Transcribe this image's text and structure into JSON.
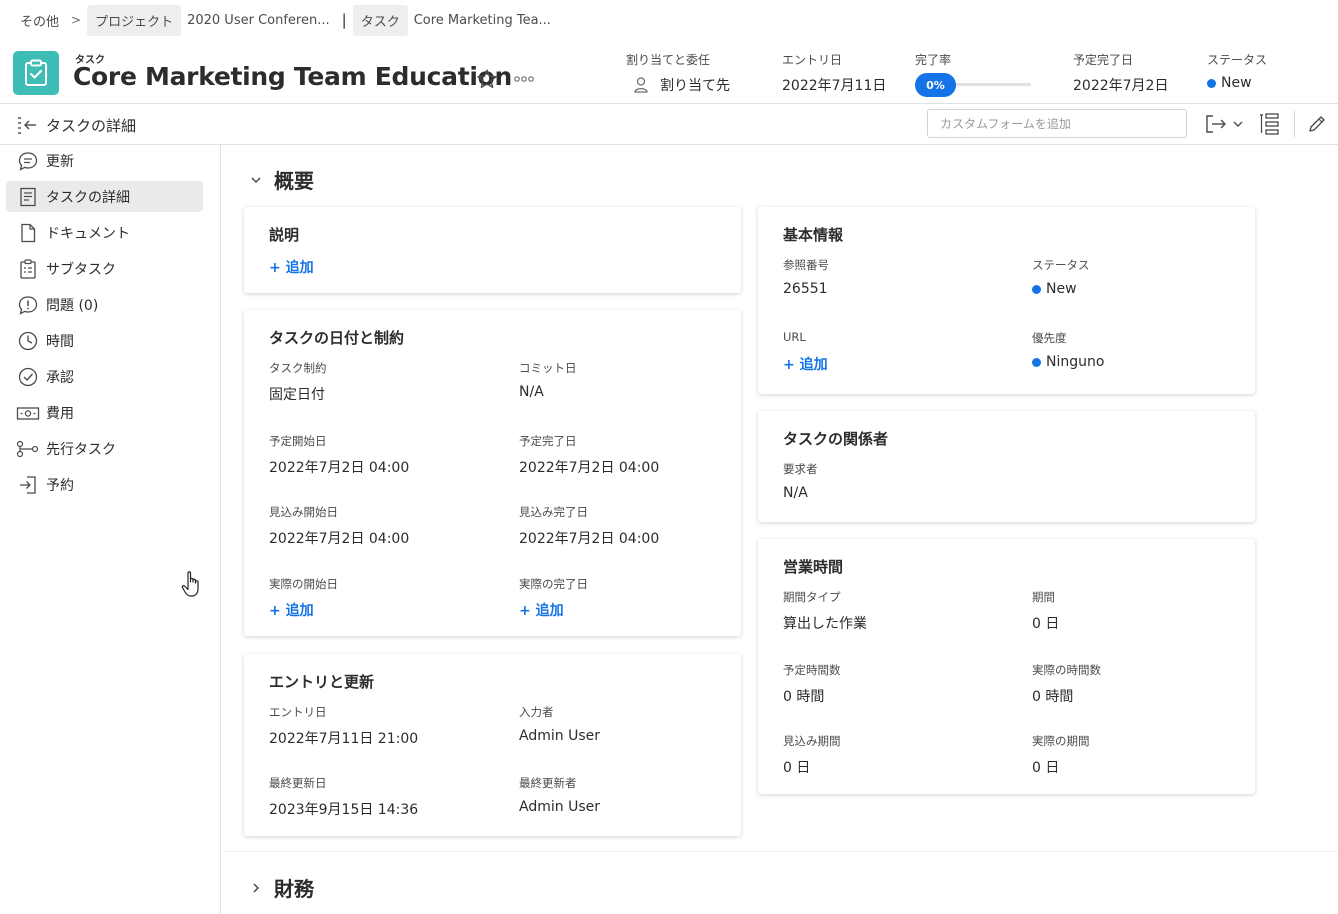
{
  "breadcrumb": {
    "items": [
      "その他",
      "プロジェクト",
      "2020 User Conferen...",
      "タスク",
      "Core Marketing Tea..."
    ],
    "separator": ">",
    "pipe": "|"
  },
  "header": {
    "object_label": "タスク",
    "title": "Core Marketing Team Education",
    "fields": {
      "assign_label": "割り当てと委任",
      "assign_value": "割り当て先",
      "entry_label": "エントリ日",
      "entry_value": "2022年7月11日",
      "complete_label": "完了率",
      "complete_value": "0%",
      "complete_fraction": 0,
      "planned_label": "予定完了日",
      "planned_value": "2022年7月2日",
      "status_label": "ステータス",
      "status_value": "New"
    },
    "icons": [
      "clipboard-icon",
      "star-icon",
      "more-icon",
      "user-icon"
    ]
  },
  "toolbar": {
    "title": "タスクの詳細",
    "custom_form_placeholder": "カスタムフォームを追加",
    "icons": [
      "collapse-panel-icon",
      "export-icon",
      "chevron-down-icon",
      "layout-list-icon",
      "edit-icon"
    ]
  },
  "sidebar": {
    "items": [
      {
        "label": "更新",
        "icon": "comment-icon"
      },
      {
        "label": "タスクの詳細",
        "icon": "details-icon",
        "active": true
      },
      {
        "label": "ドキュメント",
        "icon": "document-icon"
      },
      {
        "label": "サブタスク",
        "icon": "subtask-icon"
      },
      {
        "label": "問題 (0)",
        "icon": "issue-icon"
      },
      {
        "label": "時間",
        "icon": "clock-icon"
      },
      {
        "label": "承認",
        "icon": "approval-icon"
      },
      {
        "label": "費用",
        "icon": "expense-icon"
      },
      {
        "label": "先行タスク",
        "icon": "predecessor-icon"
      },
      {
        "label": "予約",
        "icon": "booking-icon"
      }
    ]
  },
  "sections": {
    "overview": "概要",
    "finance": "財務"
  },
  "cards": {
    "description": {
      "title": "説明",
      "add": "+ 追加"
    },
    "dates": {
      "title": "タスクの日付と制約",
      "constraint_label": "タスク制約",
      "constraint_value": "固定日付",
      "commit_label": "コミット日",
      "commit_value": "N/A",
      "planned_start_label": "予定開始日",
      "planned_start_value": "2022年7月2日 04:00",
      "planned_end_label": "予定完了日",
      "planned_end_value": "2022年7月2日 04:00",
      "projected_start_label": "見込み開始日",
      "projected_start_value": "2022年7月2日 04:00",
      "projected_end_label": "見込み完了日",
      "projected_end_value": "2022年7月2日 04:00",
      "actual_start_label": "実際の開始日",
      "actual_start_add": "+ 追加",
      "actual_end_label": "実際の完了日",
      "actual_end_add": "+ 追加"
    },
    "entry": {
      "title": "エントリと更新",
      "entry_date_label": "エントリ日",
      "entry_date_value": "2022年7月11日 21:00",
      "entered_by_label": "入力者",
      "entered_by_value": "Admin User",
      "last_updated_label": "最終更新日",
      "last_updated_value": "2023年9月15日 14:36",
      "last_updated_by_label": "最終更新者",
      "last_updated_by_value": "Admin User"
    },
    "basic": {
      "title": "基本情報",
      "ref_label": "参照番号",
      "ref_value": "26551",
      "status_label": "ステータス",
      "status_value": "New",
      "url_label": "URL",
      "url_add": "+ 追加",
      "priority_label": "優先度",
      "priority_value": "Ninguno",
      "dot_color": "#1473e6"
    },
    "stakeholders": {
      "title": "タスクの関係者",
      "requester_label": "要求者",
      "requester_value": "N/A"
    },
    "hours": {
      "title": "営業時間",
      "duration_type_label": "期間タイプ",
      "duration_type_value": "算出した作業",
      "duration_label": "期間",
      "duration_value": "0 日",
      "planned_hours_label": "予定時間数",
      "planned_hours_value": "0 時間",
      "actual_hours_label": "実際の時間数",
      "actual_hours_value": "0 時間",
      "projected_duration_label": "見込み期間",
      "projected_duration_value": "0 日",
      "actual_duration_label": "実際の期間",
      "actual_duration_value": "0 日"
    }
  },
  "colors": {
    "accent": "#1473e6",
    "task_icon_bg": "#3dbdb5",
    "active_nav": "#eaeaea"
  }
}
